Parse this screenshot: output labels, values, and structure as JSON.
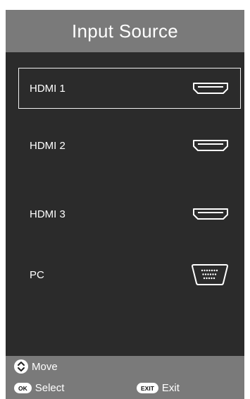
{
  "header": {
    "title": "Input Source"
  },
  "sources": [
    {
      "label": "HDMI 1",
      "icon": "hdmi-port-icon",
      "selected": true
    },
    {
      "label": "HDMI 2",
      "icon": "hdmi-port-icon",
      "selected": false
    },
    {
      "label": "HDMI 3",
      "icon": "hdmi-port-icon",
      "selected": false
    },
    {
      "label": "PC",
      "icon": "vga-port-icon",
      "selected": false
    }
  ],
  "footer": {
    "move": {
      "key_icon": "up-down-arrows-icon",
      "label": "Move"
    },
    "select": {
      "key_label": "OK",
      "label": "Select"
    },
    "exit": {
      "key_label": "EXIT",
      "label": "Exit"
    }
  },
  "colors": {
    "panel_background": "#2b2b2b",
    "header_background": "#7a7a7a",
    "footer_background": "#7a7a7a",
    "text": "#ffffff",
    "selection_border": "#f0f0f0"
  }
}
